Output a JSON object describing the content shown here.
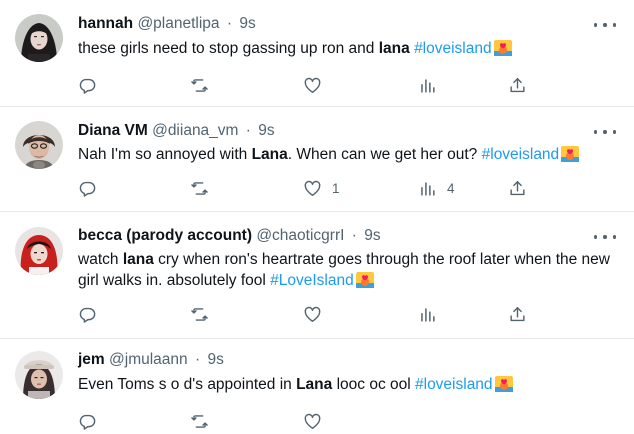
{
  "tweets": [
    {
      "name": "hannah",
      "handle": "@planetlipa",
      "separator": "·",
      "time": "9s",
      "text": {
        "pre": "these girls need to stop gassing up ron and ",
        "bold": "lana",
        "mid": " ",
        "hashtag": "#loveisland",
        "post": ""
      },
      "counts": {
        "reply": "",
        "retweet": "",
        "like": "",
        "views": ""
      }
    },
    {
      "name": "Diana VM",
      "handle": "@diiana_vm",
      "separator": "·",
      "time": "9s",
      "text": {
        "pre": "Nah I'm so annoyed with ",
        "bold": "Lana",
        "mid": ". When can we get her out? ",
        "hashtag": "#loveisland",
        "post": ""
      },
      "counts": {
        "reply": "",
        "retweet": "",
        "like": "1",
        "views": "4"
      }
    },
    {
      "name": "becca (parody account)",
      "handle": "@chaoticgrrI",
      "separator": "·",
      "time": "9s",
      "text": {
        "pre": "watch ",
        "bold": "lana",
        "mid": " cry when ron's heartrate goes through the roof later when the new girl walks in. absolutely fool ",
        "hashtag": "#LoveIsland",
        "post": ""
      },
      "counts": {
        "reply": "",
        "retweet": "",
        "like": "",
        "views": ""
      }
    },
    {
      "name": "jem",
      "handle": "@jmulaann",
      "separator": "·",
      "time": "9s",
      "text": {
        "pre": "Even Toms s o d's appointed in ",
        "bold": "Lana",
        "mid": " looc oc ool ",
        "hashtag": "#loveisland",
        "post": ""
      },
      "counts": {
        "reply": "",
        "retweet": "",
        "like": "",
        "views": ""
      }
    }
  ],
  "icons": {
    "reply": "reply-icon",
    "retweet": "retweet-icon",
    "like": "heart-icon",
    "views": "views-chart-icon",
    "share": "share-icon",
    "more": "more-options-icon",
    "hashtag_emoji": "love-island-sun-emoji-icon"
  },
  "colors": {
    "text": "#0f1419",
    "secondary": "#536471",
    "link": "#1d9bf0",
    "divider": "#e6e9ec"
  }
}
